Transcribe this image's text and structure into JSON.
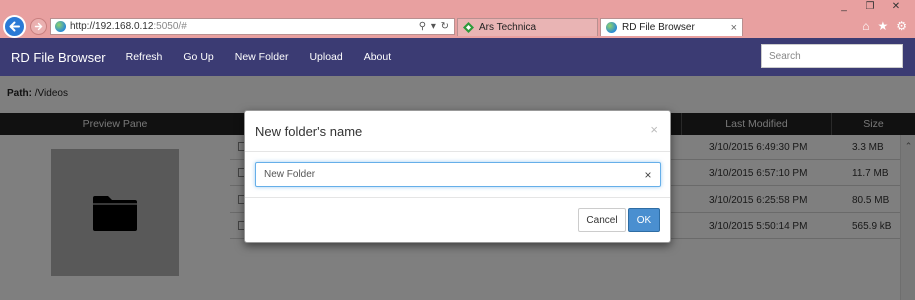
{
  "browser": {
    "window_controls": [
      "_",
      "❐",
      "✕"
    ],
    "url_host": "http://192.168.0.12",
    "url_rest": ":5050/#",
    "address_tools": "⚲ ▾ ↻",
    "tabs": [
      {
        "label": "Ars Technica"
      },
      {
        "label": "RD File Browser",
        "close": "×"
      }
    ],
    "toolbar_icons": [
      "⌂",
      "★",
      "⚙"
    ]
  },
  "app": {
    "brand": "RD File Browser",
    "nav": [
      "Refresh",
      "Go Up",
      "New Folder",
      "Upload",
      "About"
    ],
    "search": {
      "placeholder": "Search",
      "value": ""
    }
  },
  "path": {
    "label": "Path:",
    "value": "/Videos"
  },
  "table": {
    "headers": {
      "preview": "Preview Pane",
      "modified": "Last Modified",
      "size": "Size"
    },
    "rows": [
      {
        "modified": "3/10/2015 6:49:30 PM",
        "size": "3.3 MB"
      },
      {
        "modified": "3/10/2015 6:57:10 PM",
        "size": "11.7 MB"
      },
      {
        "modified": "3/10/2015 6:25:58 PM",
        "size": "80.5 MB"
      },
      {
        "modified": "3/10/2015 5:50:14 PM",
        "size": "565.9 kB"
      }
    ]
  },
  "modal": {
    "title": "New folder's name",
    "close": "×",
    "input_value": "New Folder",
    "clear": "×",
    "cancel": "Cancel",
    "ok": "OK"
  },
  "colors": {
    "browser_chrome": "#e8a0a0",
    "navbar": "#3b3b73",
    "ok_button": "#4a8fd0"
  }
}
